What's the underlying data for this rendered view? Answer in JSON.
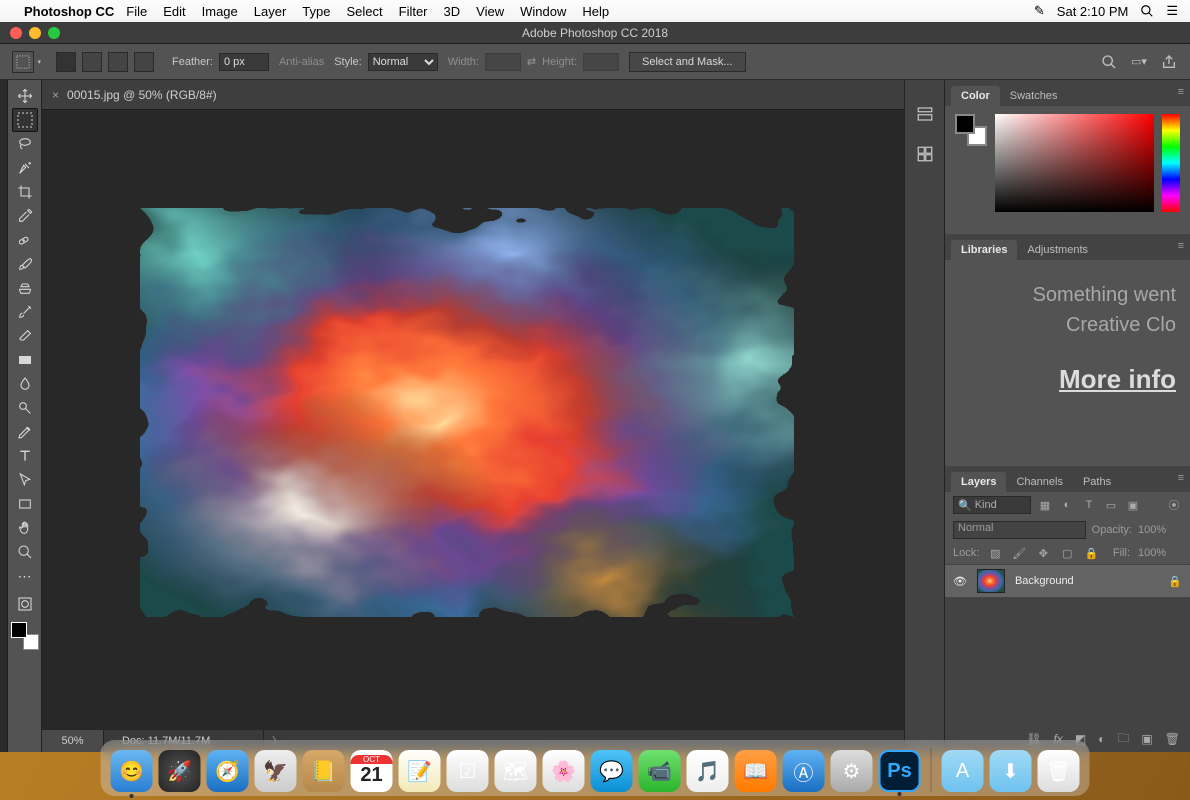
{
  "mac_menu": {
    "app_name": "Photoshop CC",
    "items": [
      "File",
      "Edit",
      "Image",
      "Layer",
      "Type",
      "Select",
      "Filter",
      "3D",
      "View",
      "Window",
      "Help"
    ],
    "clock": "Sat 2:10 PM"
  },
  "window": {
    "title": "Adobe Photoshop CC 2018"
  },
  "options_bar": {
    "feather_label": "Feather:",
    "feather_value": "0 px",
    "anti_alias": "Anti-alias",
    "style_label": "Style:",
    "style_value": "Normal",
    "width_label": "Width:",
    "height_label": "Height:",
    "select_mask": "Select and Mask..."
  },
  "document": {
    "tab": "00015.jpg @ 50% (RGB/8#)",
    "zoom": "50%",
    "info": "Doc: 11.7M/11.7M"
  },
  "panels": {
    "color_tab": "Color",
    "swatches_tab": "Swatches",
    "libraries_tab": "Libraries",
    "adjustments_tab": "Adjustments",
    "lib_line1": "Something went",
    "lib_line2": "Creative Clo",
    "lib_more": "More info",
    "layers_tab": "Layers",
    "channels_tab": "Channels",
    "paths_tab": "Paths",
    "kind_label": "Kind",
    "blend_mode": "Normal",
    "opacity_label": "Opacity:",
    "opacity_value": "100%",
    "lock_label": "Lock:",
    "fill_label": "Fill:",
    "fill_value": "100%",
    "layer_name": "Background"
  },
  "dock": {
    "date_day": "21",
    "date_month": "OCT"
  }
}
